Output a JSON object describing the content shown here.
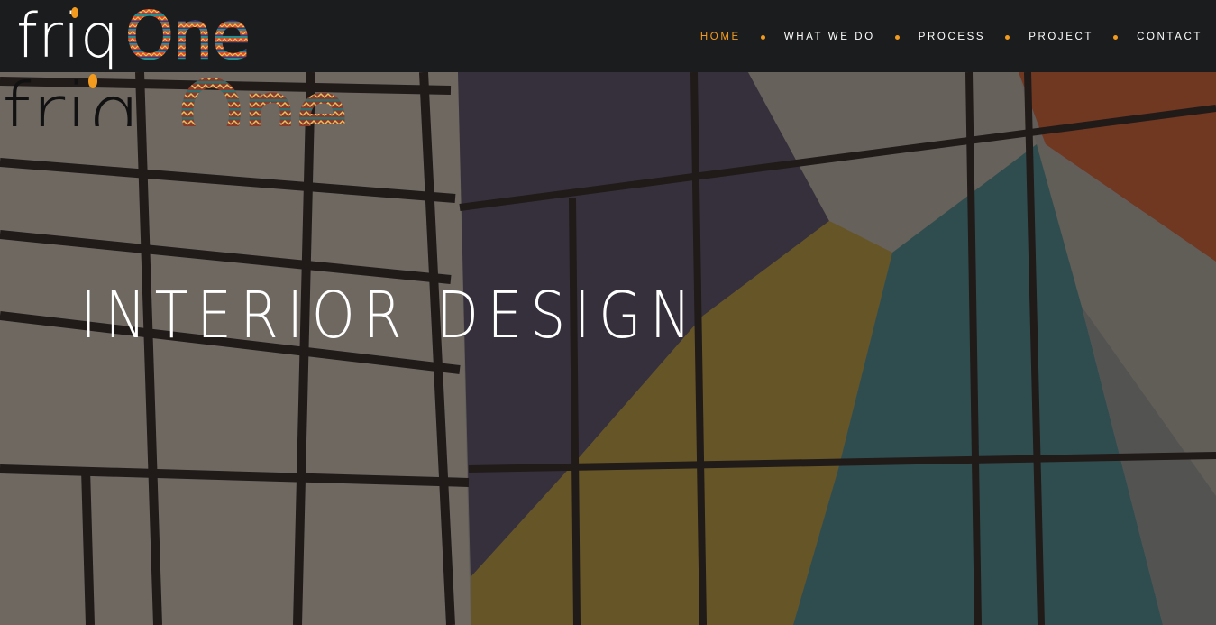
{
  "brand": {
    "name_part1": "friq",
    "name_part2": "One",
    "accent_color": "#f29b1e",
    "logo_icon": "friqone-logo-icon"
  },
  "nav": {
    "items": [
      {
        "label": "HOME",
        "active": true
      },
      {
        "label": "WHAT WE DO",
        "active": false
      },
      {
        "label": "PROCESS",
        "active": false
      },
      {
        "label": "PROJECT",
        "active": false
      },
      {
        "label": "CONTACT",
        "active": false
      }
    ],
    "separator_icon": "dot-icon"
  },
  "hero": {
    "title": "INTERIOR DESIGN",
    "background": "geometric-painted-wall-image"
  },
  "colors": {
    "nav_bg": "#1b1c1e",
    "text": "#ffffff",
    "active": "#f29b1e"
  }
}
